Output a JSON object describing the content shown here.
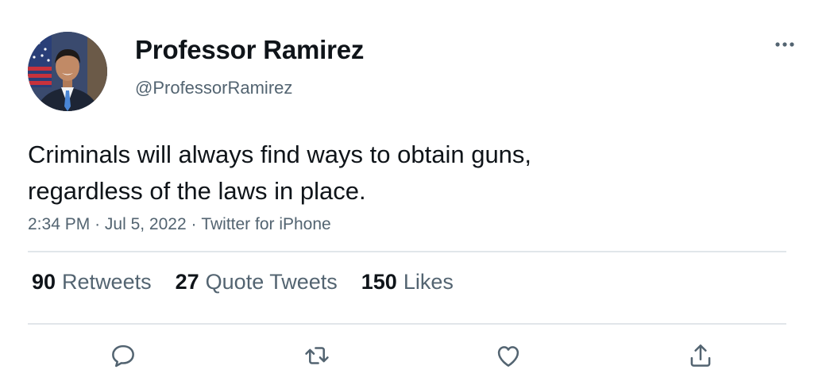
{
  "user": {
    "display_name": "Professor Ramirez",
    "handle": "@ProfessorRamirez",
    "avatar_icon": "profile-photo"
  },
  "tweet": {
    "lines": [
      "Criminals will always find ways to obtain guns,",
      "regardless of the laws in place."
    ],
    "time": "2:34 PM",
    "date": "Jul 5, 2022",
    "source": "Twitter for iPhone",
    "separator": "·"
  },
  "stats": {
    "retweets": {
      "count": "90",
      "label": "Retweets"
    },
    "quote_tweets": {
      "count": "27",
      "label": "Quote Tweets"
    },
    "likes": {
      "count": "150",
      "label": "Likes"
    }
  },
  "actions": [
    {
      "icon": "reply-icon"
    },
    {
      "icon": "retweet-icon"
    },
    {
      "icon": "like-icon"
    },
    {
      "icon": "share-icon"
    }
  ],
  "colors": {
    "text_primary": "#0f1419",
    "text_secondary": "#536471",
    "divider": "#e1e6ea"
  }
}
